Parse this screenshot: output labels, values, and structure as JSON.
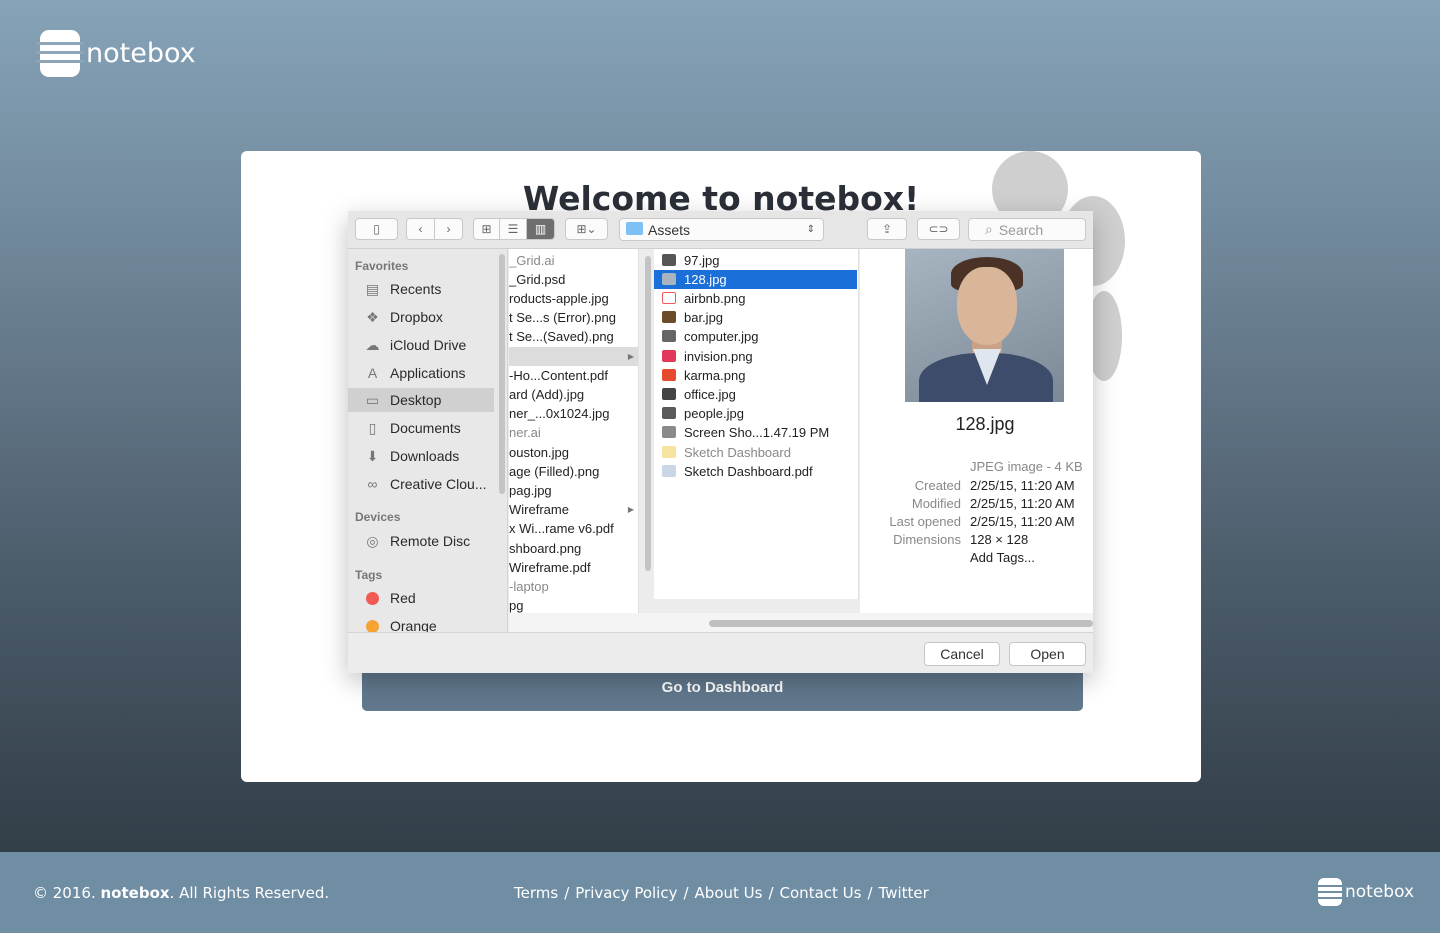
{
  "brand": {
    "name": "notebox"
  },
  "card": {
    "welcome": "Welcome to notebox!",
    "dashboard_button": "Go to Dashboard"
  },
  "dialog": {
    "path_folder": "Assets",
    "search_placeholder": "Search",
    "sidebar": {
      "favorites_heading": "Favorites",
      "favorites": [
        {
          "label": "Recents",
          "icon": "recents-icon"
        },
        {
          "label": "Dropbox",
          "icon": "dropbox-icon"
        },
        {
          "label": "iCloud Drive",
          "icon": "icloud-icon"
        },
        {
          "label": "Applications",
          "icon": "applications-icon"
        },
        {
          "label": "Desktop",
          "icon": "desktop-icon"
        },
        {
          "label": "Documents",
          "icon": "documents-icon"
        },
        {
          "label": "Downloads",
          "icon": "downloads-icon"
        },
        {
          "label": "Creative Clou...",
          "icon": "creative-cloud-icon"
        }
      ],
      "devices_heading": "Devices",
      "devices": [
        {
          "label": "Remote Disc",
          "icon": "disc-icon"
        }
      ],
      "tags_heading": "Tags",
      "tags": [
        {
          "label": "Red",
          "color": "#f05a52"
        },
        {
          "label": "Orange",
          "color": "#f6a334"
        }
      ]
    },
    "column1": [
      "_Grid.ai",
      "_Grid.psd",
      "roducts-apple.jpg",
      "t Se...s (Error).png",
      "t Se...(Saved).png",
      "",
      "-Ho...Content.pdf",
      "ard (Add).jpg",
      "ner_...0x1024.jpg",
      "ner.ai",
      "ouston.jpg",
      "age (Filled).png",
      "pag.jpg",
      "Wireframe",
      "x Wi...rame v6.pdf",
      "shboard.png",
      "Wireframe.pdf",
      "-laptop",
      "pg"
    ],
    "column2": [
      "97.jpg",
      "128.jpg",
      "airbnb.png",
      "bar.jpg",
      "computer.jpg",
      "invision.png",
      "karma.png",
      "office.jpg",
      "people.jpg",
      "Screen Sho...1.47.19 PM",
      "Sketch Dashboard",
      "Sketch Dashboard.pdf"
    ],
    "preview": {
      "filename": "128.jpg",
      "kind": "JPEG image - 4 KB",
      "created_label": "Created",
      "created": "2/25/15, 11:20 AM",
      "modified_label": "Modified",
      "modified": "2/25/15, 11:20 AM",
      "last_opened_label": "Last opened",
      "last_opened": "2/25/15, 11:20 AM",
      "dimensions_label": "Dimensions",
      "dimensions": "128 × 128",
      "add_tags": "Add Tags..."
    },
    "cancel": "Cancel",
    "open": "Open"
  },
  "footer": {
    "copy_prefix": "© 2016.",
    "copy_brand": "notebox",
    "copy_suffix": ". All Rights Reserved.",
    "links": [
      "Terms",
      "Privacy Policy",
      "About Us",
      "Contact Us",
      "Twitter"
    ],
    "separator": "/",
    "brand": "notebox"
  }
}
